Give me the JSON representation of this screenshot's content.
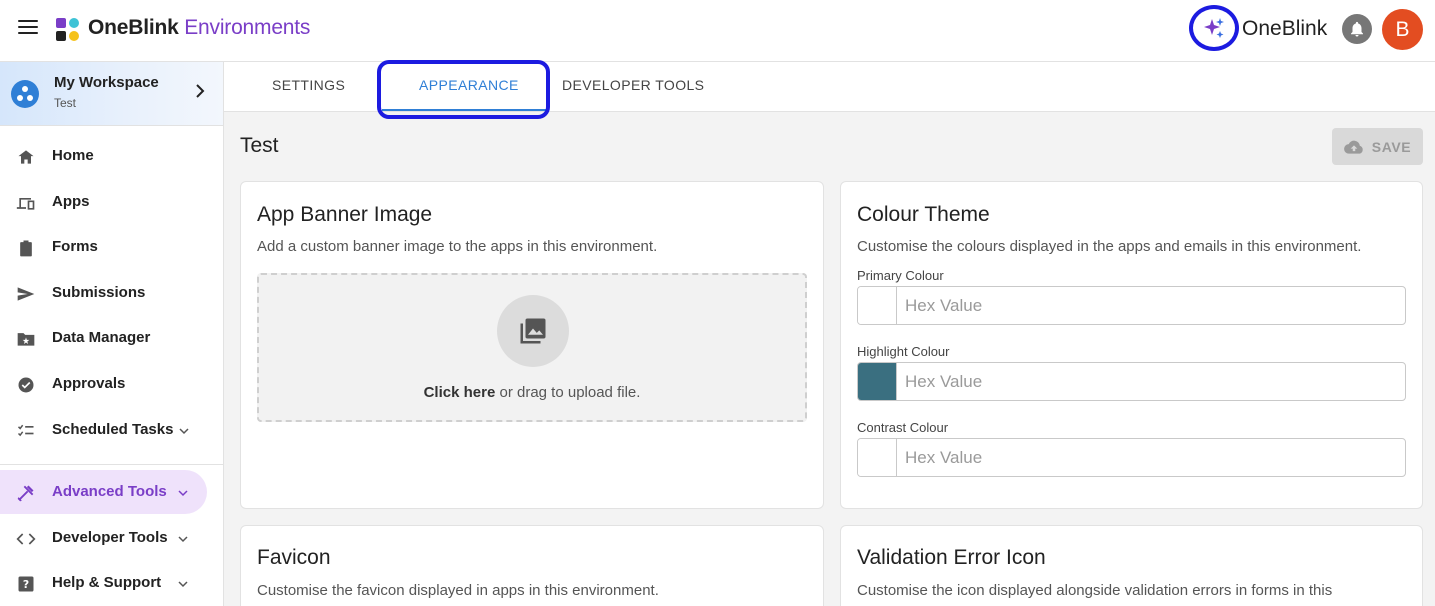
{
  "header": {
    "brand_bold": "OneBlink",
    "brand_light": " Environments",
    "right_brand": "OneBlink",
    "avatar_initial": "B",
    "icons": [
      "menu-icon",
      "oneblink-logo",
      "sparkle-ai-icon",
      "bell-icon"
    ]
  },
  "sidebar": {
    "workspace": {
      "name": "My Workspace",
      "sub": "Test"
    },
    "items": [
      {
        "label": "Home",
        "icon": "home-icon"
      },
      {
        "label": "Apps",
        "icon": "devices-icon"
      },
      {
        "label": "Forms",
        "icon": "clipboard-icon"
      },
      {
        "label": "Submissions",
        "icon": "send-icon"
      },
      {
        "label": "Data Manager",
        "icon": "folder-star-icon"
      },
      {
        "label": "Approvals",
        "icon": "check-circle-icon"
      },
      {
        "label": "Scheduled Tasks",
        "icon": "checklist-icon",
        "expandable": true
      },
      {
        "label": "Advanced Tools",
        "icon": "tools-icon",
        "expandable": true,
        "active": true
      },
      {
        "label": "Developer Tools",
        "icon": "code-icon",
        "expandable": true
      },
      {
        "label": "Help & Support",
        "icon": "help-icon",
        "expandable": true
      }
    ]
  },
  "tabs": [
    {
      "label": "SETTINGS"
    },
    {
      "label": "APPEARANCE",
      "active": true
    },
    {
      "label": "DEVELOPER TOOLS"
    }
  ],
  "page": {
    "title": "Test",
    "save_label": "SAVE"
  },
  "banner_card": {
    "title": "App Banner Image",
    "desc": "Add a custom banner image to the apps in this environment.",
    "upload_link": "Click here",
    "upload_rest": " or drag to upload file."
  },
  "colour_card": {
    "title": "Colour Theme",
    "desc": "Customise the colours displayed in the apps and emails in this environment.",
    "fields": [
      {
        "label": "Primary Colour",
        "placeholder": "Hex Value",
        "swatch": "#ffffff"
      },
      {
        "label": "Highlight Colour",
        "placeholder": "Hex Value",
        "swatch": "#3a6f80"
      },
      {
        "label": "Contrast Colour",
        "placeholder": "Hex Value",
        "swatch": "#ffffff"
      }
    ]
  },
  "favicon_card": {
    "title": "Favicon",
    "desc": "Customise the favicon displayed in apps in this environment."
  },
  "validation_card": {
    "title": "Validation Error Icon",
    "desc": "Customise the icon displayed alongside validation errors in forms in this"
  },
  "colors": {
    "accent_purple": "#7a3ec7",
    "accent_blue": "#2f7fd6",
    "avatar": "#e34d21",
    "focus_ring": "#1c1be0"
  }
}
